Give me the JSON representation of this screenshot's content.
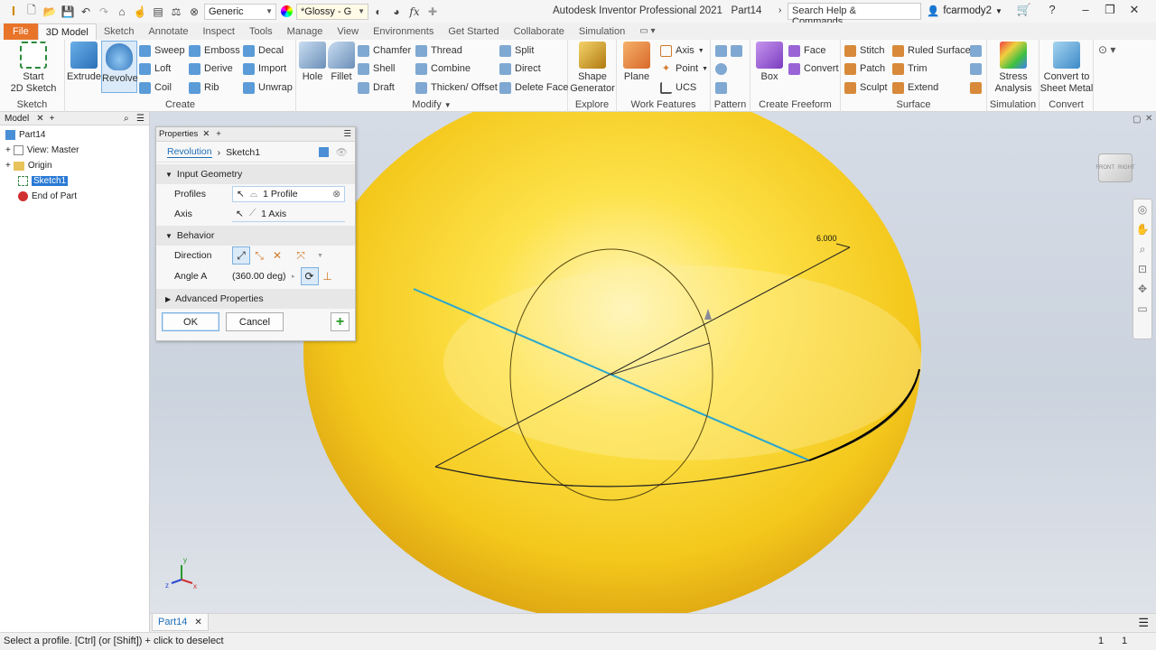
{
  "title_bar": {
    "material": "Generic",
    "appearance": "*Glossy - G",
    "app_title": "Autodesk Inventor Professional 2021",
    "doc_title": "Part14",
    "search_placeholder": "Search Help & Commands...",
    "user": "fcarmody2"
  },
  "menu_tabs": [
    "File",
    "3D Model",
    "Sketch",
    "Annotate",
    "Inspect",
    "Tools",
    "Manage",
    "View",
    "Environments",
    "Get Started",
    "Collaborate",
    "Simulation"
  ],
  "ribbon": {
    "sketch": {
      "title": "Sketch",
      "start_sketch": "Start\n2D Sketch"
    },
    "create": {
      "title": "Create",
      "extrude": "Extrude",
      "revolve": "Revolve",
      "sweep": "Sweep",
      "loft": "Loft",
      "coil": "Coil",
      "emboss": "Emboss",
      "derive": "Derive",
      "rib": "Rib",
      "decal": "Decal",
      "import": "Import",
      "unwrap": "Unwrap"
    },
    "modify": {
      "title": "Modify",
      "hole": "Hole",
      "fillet": "Fillet",
      "chamfer": "Chamfer",
      "shell": "Shell",
      "draft": "Draft",
      "thread": "Thread",
      "combine": "Combine",
      "thicken": "Thicken/ Offset",
      "split": "Split",
      "direct": "Direct",
      "delete_face": "Delete Face"
    },
    "explore": {
      "title": "Explore",
      "shape_generator": "Shape\nGenerator"
    },
    "work_features": {
      "title": "Work Features",
      "plane": "Plane",
      "axis": "Axis",
      "point": "Point",
      "ucs": "UCS"
    },
    "pattern": {
      "title": "Pattern"
    },
    "create_freeform": {
      "title": "Create Freeform",
      "box": "Box",
      "face": "Face",
      "convert": "Convert"
    },
    "surface": {
      "title": "Surface",
      "stitch": "Stitch",
      "patch": "Patch",
      "sculpt": "Sculpt",
      "ruled_surface": "Ruled Surface",
      "trim": "Trim",
      "extend": "Extend"
    },
    "simulation": {
      "title": "Simulation",
      "stress": "Stress\nAnalysis"
    },
    "convert": {
      "title": "Convert",
      "sheet_metal": "Convert to\nSheet Metal"
    }
  },
  "browser": {
    "tab": "Model",
    "nodes": [
      "Part14",
      "View: Master",
      "Origin",
      "Sketch1",
      "End of Part"
    ]
  },
  "properties": {
    "header": "Properties",
    "breadcrumb_feature": "Revolution",
    "breadcrumb_sketch": "Sketch1",
    "input_geometry": "Input Geometry",
    "profiles_label": "Profiles",
    "profiles_value": "1 Profile",
    "axis_label": "Axis",
    "axis_value": "1 Axis",
    "behavior": "Behavior",
    "direction_label": "Direction",
    "angle_label": "Angle A",
    "angle_value": "(360.00 deg)",
    "advanced": "Advanced Properties",
    "ok": "OK",
    "cancel": "Cancel"
  },
  "viewport": {
    "dimension": "6.000",
    "viewcube_front": "FRONT",
    "viewcube_right": "RIGHT",
    "axes": {
      "z": "z",
      "x": "x",
      "y": "y"
    }
  },
  "doc_tab": "Part14",
  "status": {
    "message": "Select a profile. [Ctrl] (or [Shift]) + click to deselect",
    "count1": "1",
    "count2": "1"
  },
  "colors": {
    "accent": "#e8742a",
    "link": "#1f6fb8",
    "sphere": "#f4c81c",
    "axis_line": "#2aa6cf"
  }
}
